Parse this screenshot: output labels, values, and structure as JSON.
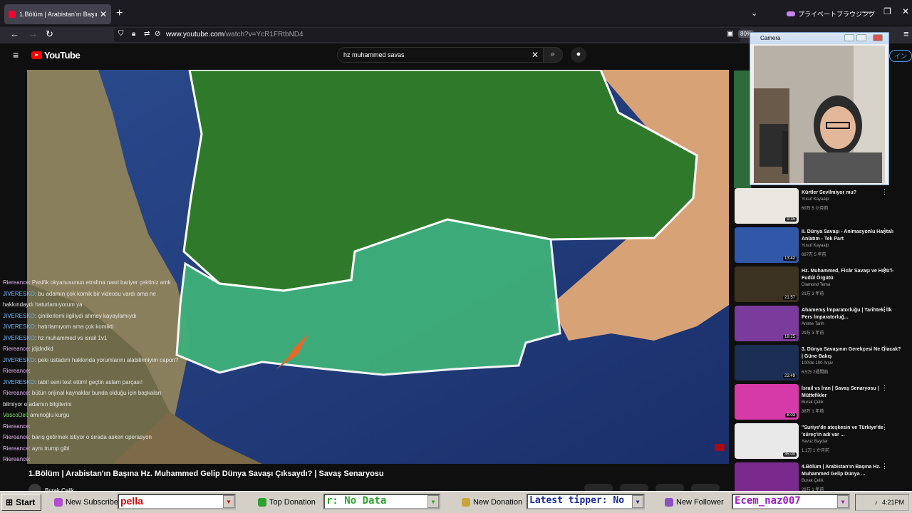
{
  "browser": {
    "tab_title": "1.Bölüm | Arabistan'ın Başına H",
    "tab_close": "✕",
    "new_tab": "+",
    "private_label": "プライベートブラウジング",
    "url_host": "www.youtube.com",
    "url_path": "/watch?v=YcR1FRtbND4",
    "zoom": "80%"
  },
  "youtube": {
    "logo_text": "YouTube",
    "search_query": "hz muhammed savas",
    "signin": "イン",
    "video_title": "1.Bölüm | Arabistan'ın Başına Hz. Muhammed Gelip Dünya Savaşı Çıksaydı? | Savaş Senaryosu",
    "channel": "Burak Çelik"
  },
  "chat": [
    {
      "name": "Riereance",
      "msg": ": Pasifik okyanusunun etrafına nasıl bariyer çektiniz amk",
      "color": "n1"
    },
    {
      "name": "JIVERESKO",
      "msg": ": bu adamın çok komik bir videosu vardı ama ne hakkındaydı haturlamıyorum ya",
      "color": "n2"
    },
    {
      "name": "JIVERESKO",
      "msg": ": çinlilerlemi ilgiliydi ahmey kayaylamıydı",
      "color": "n2"
    },
    {
      "name": "JIVERESKO",
      "msg": ": hatırlamıyom ama çok komikti",
      "color": "n2"
    },
    {
      "name": "JIVERESKO",
      "msg": ": hz muhammed vs israil 1v1",
      "color": "n2"
    },
    {
      "name": "Riereance",
      "msg": ": jdjdndkd",
      "color": "n1"
    },
    {
      "name": "JIVERESKO",
      "msg": ": peki üstadım hakkında yorumlarını alabilirmiyim capon?",
      "color": "n2"
    },
    {
      "name": "Riereance",
      "msg": ":",
      "color": "n1"
    },
    {
      "name": "JIVERESKO",
      "msg": ": tabi! seni test ettim! geçtin aslam parçası!",
      "color": "n2"
    },
    {
      "name": "Riereance",
      "msg": ": bütün orijinal kaynaklar bunda olduğu için başkaları bilmiyor o adamın bilgilerini",
      "color": "n1"
    },
    {
      "name": "VascoDel",
      "msg": ": amınoğlu kurgu",
      "color": "n3"
    },
    {
      "name": "Riereance",
      "msg": ":",
      "color": "n1"
    },
    {
      "name": "Riereance",
      "msg": ": barış getirmek istiyor o sırada askeri operasyon",
      "color": "n1"
    },
    {
      "name": "Riereance",
      "msg": ": aynı trump gibi",
      "color": "n1"
    },
    {
      "name": "Riereance",
      "msg": ":",
      "color": "n1"
    }
  ],
  "sidebar": [
    {
      "title": "Kürtler Sevilmiyor mu?",
      "channel": "Yusuf Kayaalp",
      "meta": "69万 5 か月前",
      "dur": "9:35",
      "color": "#e9e7df"
    },
    {
      "title": "II. Dünya Savaşı - Animasyonlu Haritalı Anlatım - Tek Part",
      "channel": "Yusuf Kayaalp",
      "meta": "687万 5 年前",
      "dur": "13:42",
      "color": "#3157a8"
    },
    {
      "title": "Hz. Muhammed, Ficâr Savaşı ve Hılfü'l-Fudûl Örgütü",
      "channel": "Diamond Tema",
      "meta": "21万 3 年前",
      "dur": "21:57",
      "color": "#3b3222"
    },
    {
      "title": "Ahamenış İmparatorluğu | Tarihteki İlk Pers İmparatorluğ...",
      "channel": "Anime Tarih",
      "meta": "29万 3 年前",
      "dur": "19:25",
      "color": "#7b3b9c"
    },
    {
      "title": "3. Dünya Savaşının Gerekçesi Ne Olacak? | Güne Bakış",
      "channel": "100'de 100 Arşiv",
      "meta": "6.5万 2週間前",
      "dur": "22:49",
      "color": "#1b2f55"
    },
    {
      "title": "İsrail vs İran | Savaş Senaryosu | Müttefikler",
      "channel": "Burak Çelik",
      "meta": "38万 1 年前",
      "dur": "8:03",
      "color": "#d63aa8"
    },
    {
      "title": "\"Suriye'de ateşkesin ve Türkiye'de 'süreç'in adı var ...",
      "channel": "Yavuz Baydar",
      "meta": "1.1万 1 か月前",
      "dur": "35:00",
      "color": "#e9e9e9"
    },
    {
      "title": "4.Bölüm | Arabistan'ın Başına Hz. Muhammed Gelip Dünya ...",
      "channel": "Burak Çelik",
      "meta": "29万 1 年前",
      "dur": "",
      "color": "#7a2a8c"
    }
  ],
  "camera": {
    "title": "Camera"
  },
  "taskbar": {
    "start": "Start",
    "new_subscriber": "New Subscriber",
    "sub_value": "pella",
    "top_donation": "Top Donation",
    "top_value": "r: No Data",
    "new_donation": "New Donation",
    "donation_value": "Latest tipper: No",
    "new_follower": "New Follower",
    "follower_value": "Ecem_naz007",
    "clock": "4:21PM"
  }
}
